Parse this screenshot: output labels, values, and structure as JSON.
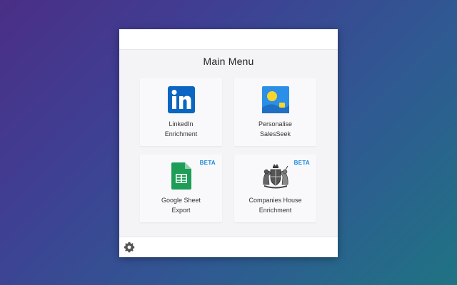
{
  "menu": {
    "title": "Main Menu",
    "tiles": [
      {
        "label_line1": "LinkedIn",
        "label_line2": "Enrichment",
        "icon": "linkedin-icon",
        "badge": ""
      },
      {
        "label_line1": "Personalise",
        "label_line2": "SalesSeek",
        "icon": "personalise-icon",
        "badge": ""
      },
      {
        "label_line1": "Google Sheet",
        "label_line2": "Export",
        "icon": "google-sheets-icon",
        "badge": "BETA"
      },
      {
        "label_line1": "Companies House",
        "label_line2": "Enrichment",
        "icon": "royal-crest-icon",
        "badge": "BETA"
      }
    ]
  },
  "footer": {
    "settings_icon": "gear-icon"
  },
  "colors": {
    "linkedin": "#0a66c2",
    "personalise_bg": "#2b8fe8",
    "personalise_dot": "#f7d629",
    "sheets": "#1e9d57",
    "beta": "#1e88d8"
  }
}
